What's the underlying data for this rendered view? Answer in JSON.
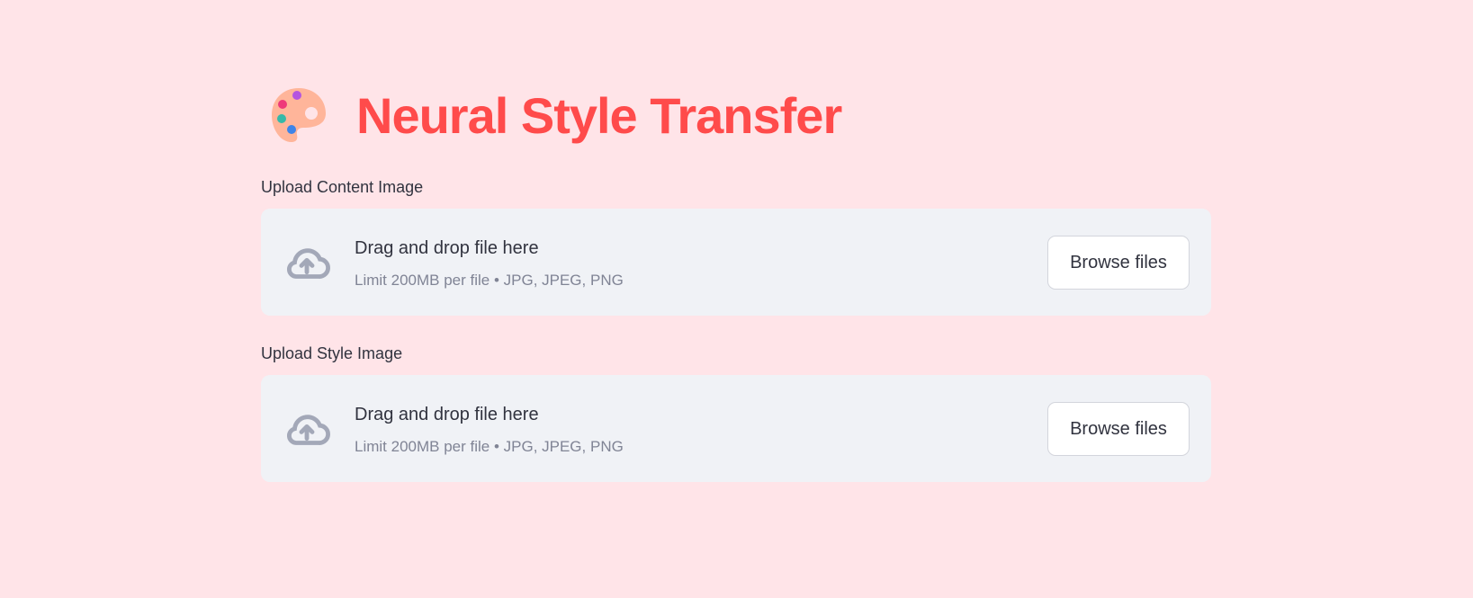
{
  "header": {
    "title": "Neural Style Transfer",
    "icon": "artist-palette-emoji"
  },
  "uploaders": [
    {
      "label": "Upload Content Image",
      "drop_text": "Drag and drop file here",
      "limit_text": "Limit 200MB per file • JPG, JPEG, PNG",
      "button_label": "Browse files",
      "icon": "cloud-upload-icon"
    },
    {
      "label": "Upload Style Image",
      "drop_text": "Drag and drop file here",
      "limit_text": "Limit 200MB per file • JPG, JPEG, PNG",
      "button_label": "Browse files",
      "icon": "cloud-upload-icon"
    }
  ],
  "colors": {
    "background": "#ffe4e8",
    "title": "#ff4b4b",
    "dropzone": "#f0f2f6",
    "icon": "#a3a8b8"
  }
}
